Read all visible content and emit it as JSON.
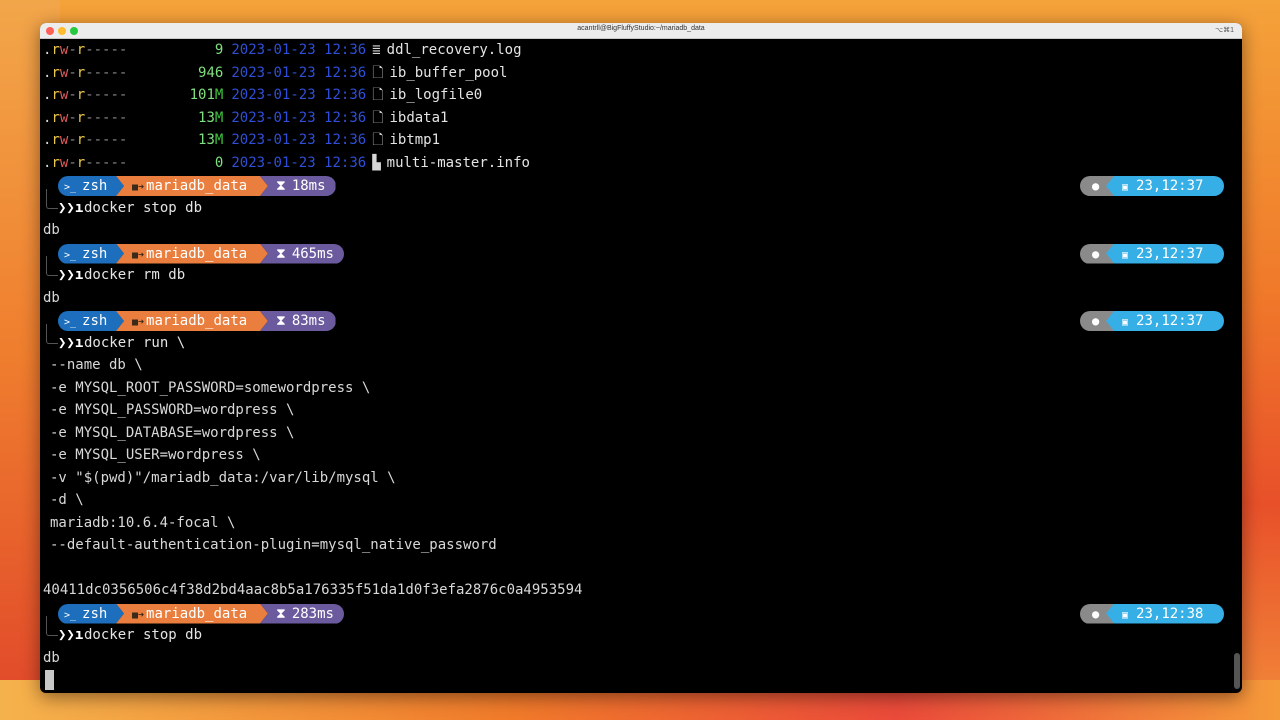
{
  "window": {
    "title": "acantrll@BigFluffyStudio:~/mariadb_data",
    "shortcut": "⌥⌘1"
  },
  "listing": [
    {
      "size": "9",
      "unit": "",
      "date": "2023-01-23 12:36",
      "icon": "text-file-icon",
      "icon_glyph": "≣",
      "name": "ddl_recovery.log"
    },
    {
      "size": "946",
      "unit": "",
      "date": "2023-01-23 12:36",
      "icon": "file-icon",
      "icon_glyph": "🗋",
      "name": "ib_buffer_pool"
    },
    {
      "size": "101",
      "unit": "M",
      "date": "2023-01-23 12:36",
      "icon": "file-icon",
      "icon_glyph": "🗋",
      "name": "ib_logfile0"
    },
    {
      "size": "13",
      "unit": "M",
      "date": "2023-01-23 12:36",
      "icon": "file-icon",
      "icon_glyph": "🗋",
      "name": "ibdata1"
    },
    {
      "size": "13",
      "unit": "M",
      "date": "2023-01-23 12:36",
      "icon": "file-icon",
      "icon_glyph": "🗋",
      "name": "ibtmp1"
    },
    {
      "size": "0",
      "unit": "",
      "date": "2023-01-23 12:36",
      "icon": "info-file-icon",
      "icon_glyph": "▙",
      "name": "multi-master.info"
    }
  ],
  "prompts": [
    {
      "shell": "zsh",
      "dir": "mariadb_data",
      "duration": "18ms",
      "clock": "23,12:37",
      "command": "docker stop db",
      "output": [
        "db"
      ]
    },
    {
      "shell": "zsh",
      "dir": "mariadb_data",
      "duration": "465ms",
      "clock": "23,12:37",
      "command": "docker rm db",
      "output": [
        "db"
      ]
    },
    {
      "shell": "zsh",
      "dir": "mariadb_data",
      "duration": "83ms",
      "clock": "23,12:37",
      "command": "docker run \\",
      "continuation": [
        "--name db \\",
        "-e MYSQL_ROOT_PASSWORD=somewordpress \\",
        "-e MYSQL_PASSWORD=wordpress \\",
        "-e MYSQL_DATABASE=wordpress \\",
        "-e MYSQL_USER=wordpress \\",
        "-v \"$(pwd)\"/mariadb_data:/var/lib/mysql \\",
        "-d \\",
        "mariadb:10.6.4-focal \\",
        "--default-authentication-plugin=mysql_native_password"
      ],
      "output": [
        "",
        "40411dc0356506c4f38d2bd4aac8b5a176335f51da1d0f3efa2876c0a4953594"
      ]
    },
    {
      "shell": "zsh",
      "dir": "mariadb_data",
      "duration": "283ms",
      "clock": "23,12:38",
      "command": "docker stop db",
      "output": [
        "db"
      ]
    }
  ],
  "colors": {
    "shell_segment": "#1d6fbe",
    "dir_segment": "#e97e3e",
    "duration_segment": "#6b5b9e",
    "os_segment": "#8a8a8a",
    "clock_segment": "#36aee6"
  }
}
